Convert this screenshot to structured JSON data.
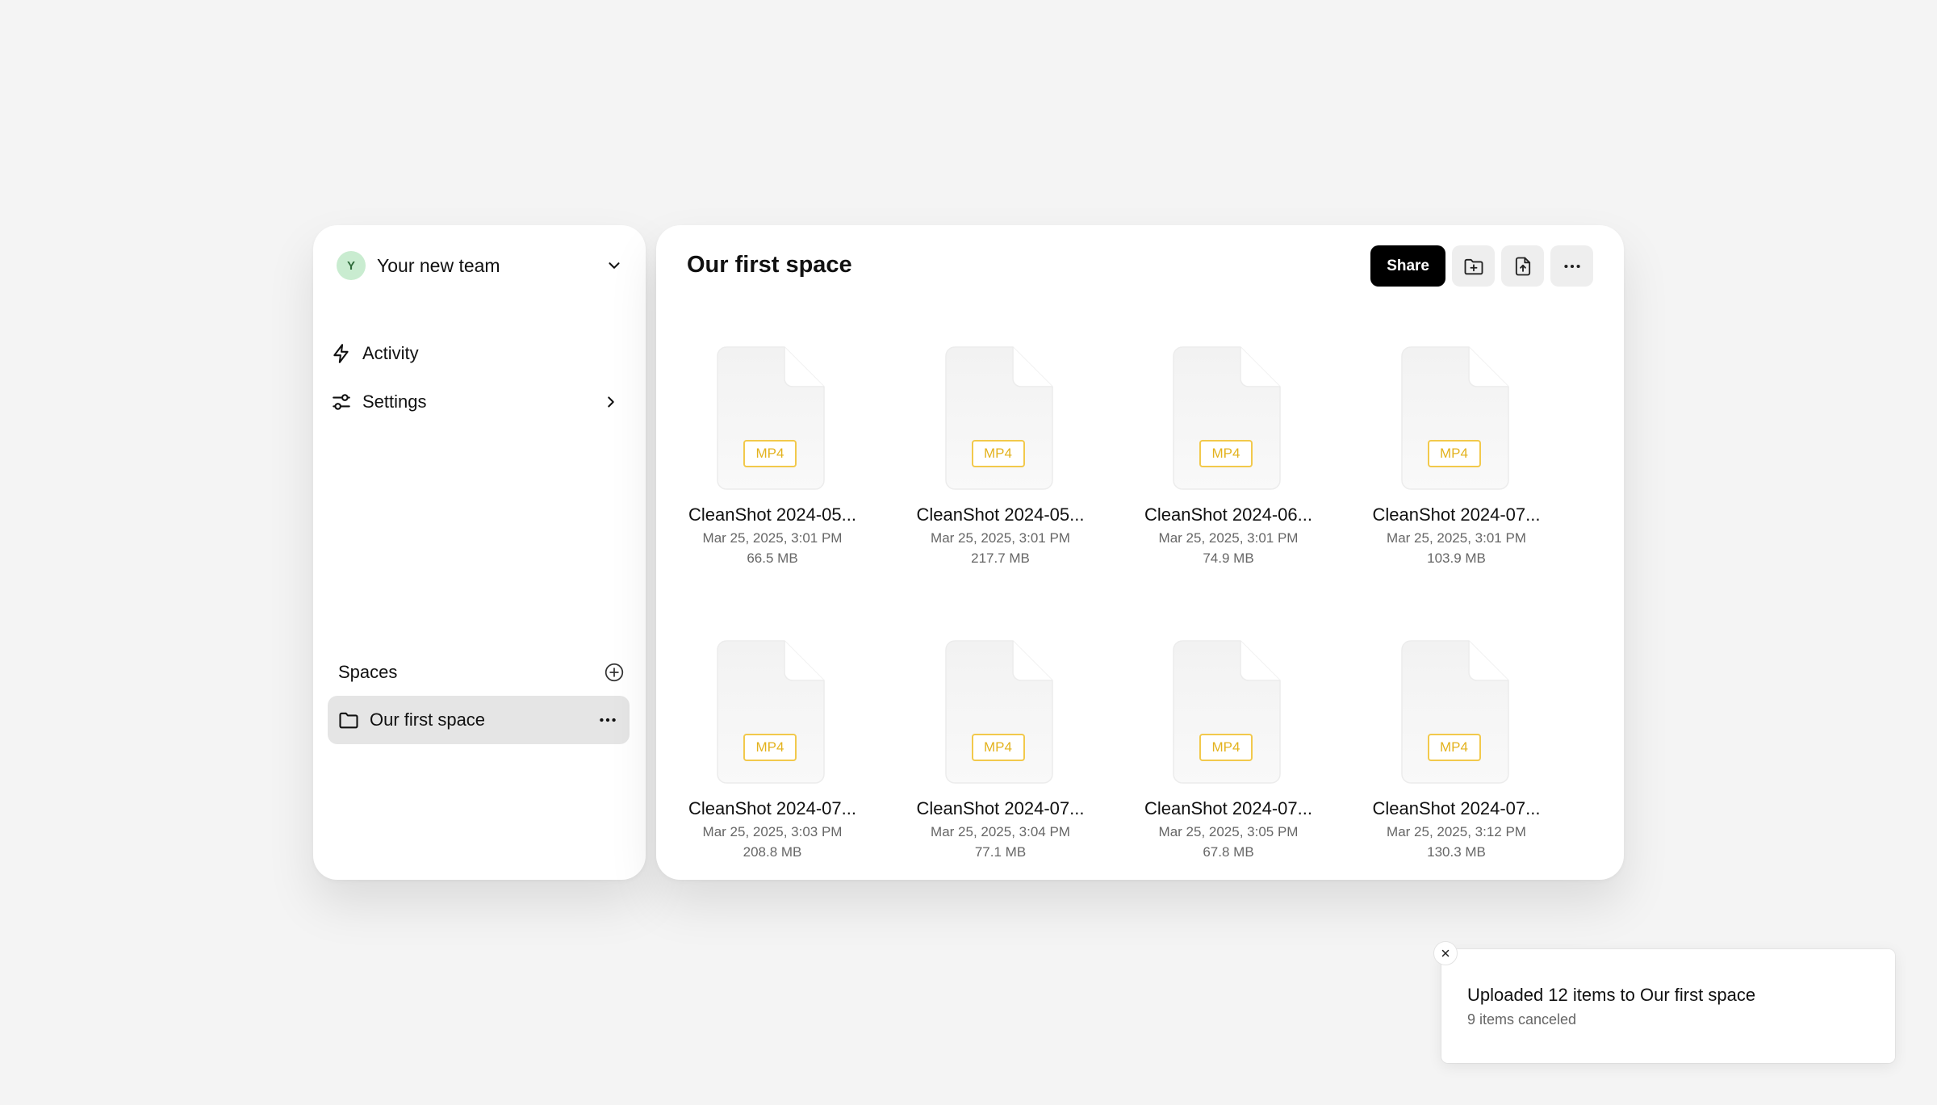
{
  "sidebar": {
    "team": {
      "avatar_letter": "Y",
      "name": "Your new team"
    },
    "nav": [
      {
        "label": "Activity",
        "icon": "lightning-icon"
      },
      {
        "label": "Settings",
        "icon": "sliders-icon"
      }
    ],
    "spaces_title": "Spaces",
    "spaces": [
      {
        "label": "Our first space",
        "icon": "folder-icon"
      }
    ]
  },
  "main": {
    "title": "Our first space",
    "share_label": "Share",
    "files": [
      {
        "name": "CleanShot 2024-05...",
        "type": "MP4",
        "date": "Mar 25, 2025, 3:01 PM",
        "size": "66.5 MB"
      },
      {
        "name": "CleanShot 2024-05...",
        "type": "MP4",
        "date": "Mar 25, 2025, 3:01 PM",
        "size": "217.7 MB"
      },
      {
        "name": "CleanShot 2024-06...",
        "type": "MP4",
        "date": "Mar 25, 2025, 3:01 PM",
        "size": "74.9 MB"
      },
      {
        "name": "CleanShot 2024-07...",
        "type": "MP4",
        "date": "Mar 25, 2025, 3:01 PM",
        "size": "103.9 MB"
      },
      {
        "name": "CleanShot 2024-07...",
        "type": "MP4",
        "date": "Mar 25, 2025, 3:03 PM",
        "size": "208.8 MB"
      },
      {
        "name": "CleanShot 2024-07...",
        "type": "MP4",
        "date": "Mar 25, 2025, 3:04 PM",
        "size": "77.1 MB"
      },
      {
        "name": "CleanShot 2024-07...",
        "type": "MP4",
        "date": "Mar 25, 2025, 3:05 PM",
        "size": "67.8 MB"
      },
      {
        "name": "CleanShot 2024-07...",
        "type": "MP4",
        "date": "Mar 25, 2025, 3:12 PM",
        "size": "130.3 MB"
      }
    ]
  },
  "toast": {
    "title": "Uploaded 12 items to Our first space",
    "subtitle": "9 items canceled"
  },
  "colors": {
    "background": "#f4f4f4",
    "badge": "#e3b21d",
    "avatar": "#c9ecd0",
    "selected": "#e5e5e5"
  }
}
